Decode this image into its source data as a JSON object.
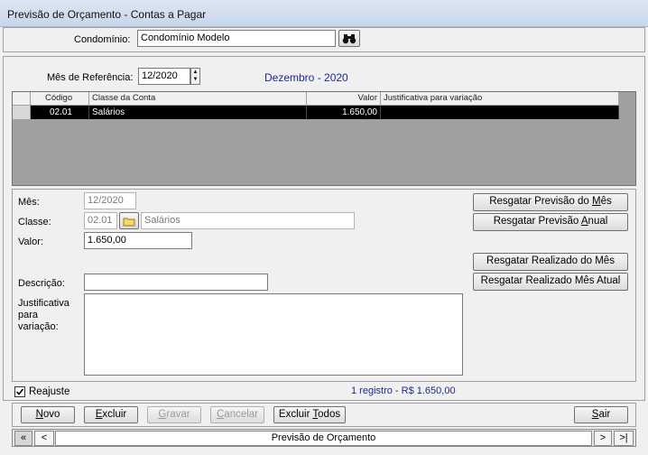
{
  "window": {
    "title": "Previsão de Orçamento - Contas a Pagar"
  },
  "condominio": {
    "label": "Condomínio:",
    "value": "Condomínio Modelo",
    "search_icon": "binoculars-icon"
  },
  "referencia": {
    "label": "Mês de Referência:",
    "value": "12/2020",
    "heading": "Dezembro - 2020"
  },
  "grid": {
    "headers": [
      "Código",
      "Classe da Conta",
      "Valor",
      "Justificativa para variação"
    ],
    "rows": [
      {
        "codigo": "02.01",
        "classe": "Salários",
        "valor": "1.650,00",
        "justificativa": ""
      }
    ]
  },
  "form": {
    "mes_label": "Mês:",
    "mes_value": "12/2020",
    "classe_label": "Classe:",
    "classe_code": "02.01",
    "classe_name": "Salários",
    "valor_label": "Valor:",
    "valor_value": "1.650,00",
    "descricao_label": "Descrição:",
    "descricao_value": "",
    "justificativa_label_1": "Justificativa",
    "justificativa_label_2": "para",
    "justificativa_label_3": "variação:",
    "justificativa_value": ""
  },
  "actions": {
    "prev_mes_pre": "Resgatar Previsão do ",
    "prev_mes_u": "M",
    "prev_mes_post": "ês",
    "prev_anual_pre": "Resgatar Previsão ",
    "prev_anual_u": "A",
    "prev_anual_post": "nual",
    "real_mes": "Resgatar Realizado do Mês",
    "real_atual": "Resgatar Realizado Mês Atual"
  },
  "reajuste": {
    "label": "Reajuste",
    "checked": true
  },
  "status": {
    "text": "1 registro - R$ 1.650,00"
  },
  "toolbar": {
    "novo_u": "N",
    "novo_rest": "ovo",
    "excluir_u": "E",
    "excluir_rest": "xcluir",
    "gravar_u": "G",
    "gravar_rest": "ravar",
    "cancelar_u": "C",
    "cancelar_rest": "ancelar",
    "excluir_todos_pre": "Excluir ",
    "excluir_todos_u": "T",
    "excluir_todos_post": "odos",
    "sair_u": "S",
    "sair_rest": "air"
  },
  "navbar": {
    "first": "«",
    "prev": "<",
    "title": "Previsão de Orçamento",
    "next": ">",
    "last": ">|"
  },
  "colors": {
    "heading": "#1a2a8c",
    "status": "#1a2a8c",
    "selected_row": "#000000"
  }
}
